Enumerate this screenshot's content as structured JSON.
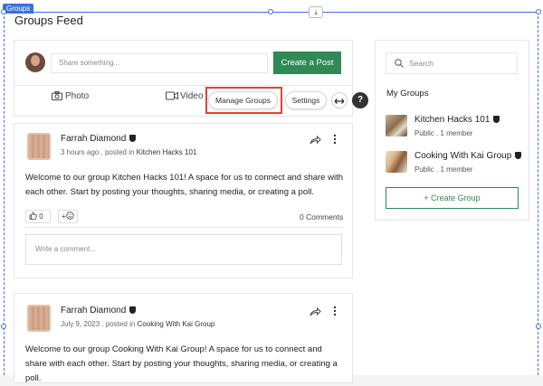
{
  "editor": {
    "selection_label": "Groups",
    "stretch_icon": "download-arrow-icon",
    "frame_color": "#3b6fe0"
  },
  "feed": {
    "title": "Groups Feed"
  },
  "composer": {
    "placeholder": "Share something...",
    "create_post_label": "Create a Post",
    "photo_label": "Photo",
    "video_label": "Video",
    "manage_groups_label": "Manage Groups",
    "settings_label": "Settings",
    "expand_icon": "expand-arrows-icon",
    "help_icon": "question-icon",
    "accent_color": "#2f8a55",
    "highlight_color": "#e0413a"
  },
  "posts": [
    {
      "author": "Farrah Diamond",
      "time": "3 hours ago",
      "posted_in_prefix": ". posted in",
      "group": "Kitchen Hacks 101",
      "text": "Welcome to our group Kitchen Hacks 101! A space for us to connect and share with each other. Start by posting your thoughts, sharing media, or creating a poll.",
      "like_count": "0",
      "add_reaction": "+",
      "comments": "0 Comments",
      "comment_placeholder": "Write a comment..."
    },
    {
      "author": "Farrah Diamond",
      "time": "July 9, 2023",
      "posted_in_prefix": ". posted in",
      "group": "Cooking With Kai Group",
      "text": "Welcome to our group Cooking With Kai Group! A space for us to connect and share with each other. Start by posting your thoughts, sharing media, or creating a poll."
    }
  ],
  "sidebar": {
    "search_placeholder": "Search",
    "my_groups_title": "My Groups",
    "groups": [
      {
        "name": "Kitchen Hacks 101",
        "meta": "Public . 1 member"
      },
      {
        "name": "Cooking With Kai Group",
        "meta": "Public . 1 member"
      }
    ],
    "create_group_label": "+ Create Group"
  }
}
